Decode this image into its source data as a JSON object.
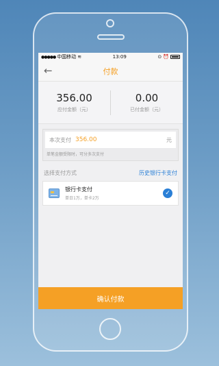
{
  "statusbar": {
    "carrier": "中国移动",
    "time": "13:09"
  },
  "navbar": {
    "back_icon": "arrow-left-icon",
    "title": "付款"
  },
  "summary": {
    "due_amount": "356.00",
    "due_label": "应付金额（元）",
    "paid_amount": "0.00",
    "paid_label": "已付金额（元）"
  },
  "payment": {
    "label": "本次支付",
    "value": "356.00",
    "unit": "元",
    "hint": "单笔金额受限时，可分多次支付"
  },
  "method": {
    "title": "选择支付方式",
    "history_link": "历史银行卡支付",
    "selected": {
      "name": "银行卡支付",
      "limit": "单日1万，单卡2万",
      "icon": "bank-card-icon"
    }
  },
  "confirm_label": "确认付款",
  "colors": {
    "accent": "#f5a025",
    "link": "#2a7fd6"
  }
}
